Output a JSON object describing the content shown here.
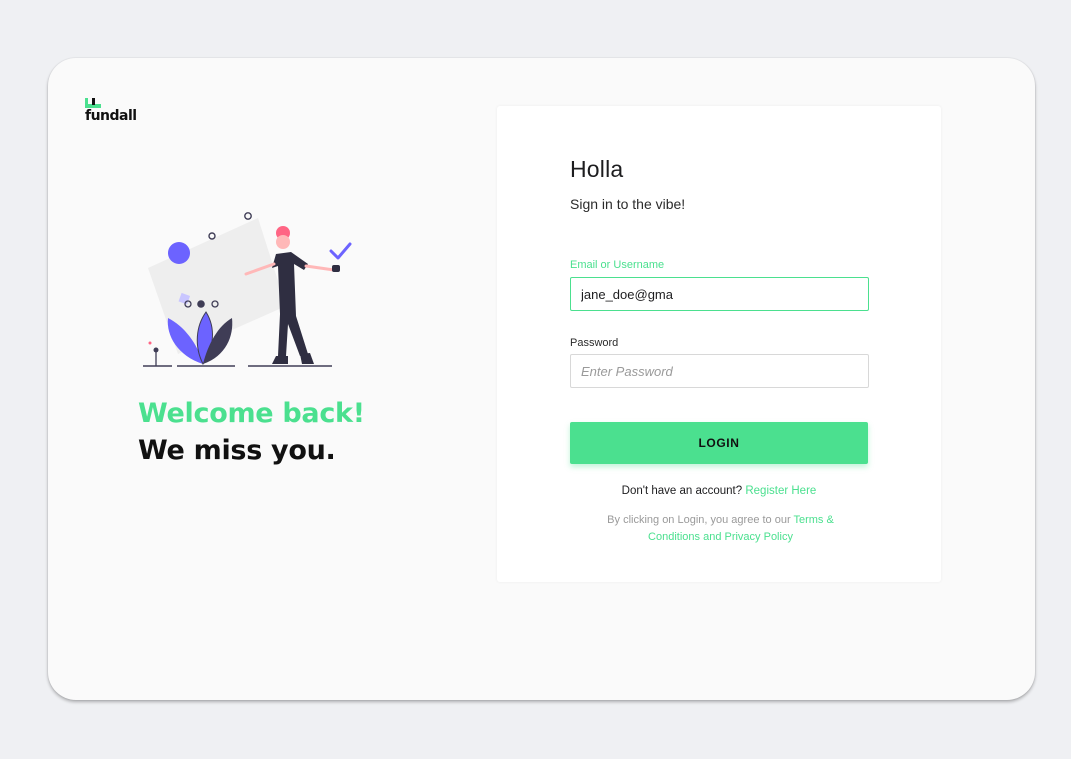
{
  "brand": {
    "name": "fundall",
    "accent": "#4be08f",
    "illustration_accent": "#6c63ff"
  },
  "hero": {
    "line1": "Welcome back!",
    "line2": "We miss you."
  },
  "form": {
    "title": "Holla",
    "subtitle": "Sign in to the vibe!",
    "email_label": "Email or Username",
    "email_value": "jane_doe@gma",
    "password_label": "Password",
    "password_placeholder": "Enter Password",
    "login_label": "LOGIN",
    "register_prompt": "Don't have an account?",
    "register_link": "Register Here",
    "terms_prefix": "By clicking on Login, you agree to our",
    "terms_link": "Terms & Conditions and Privacy Policy"
  }
}
